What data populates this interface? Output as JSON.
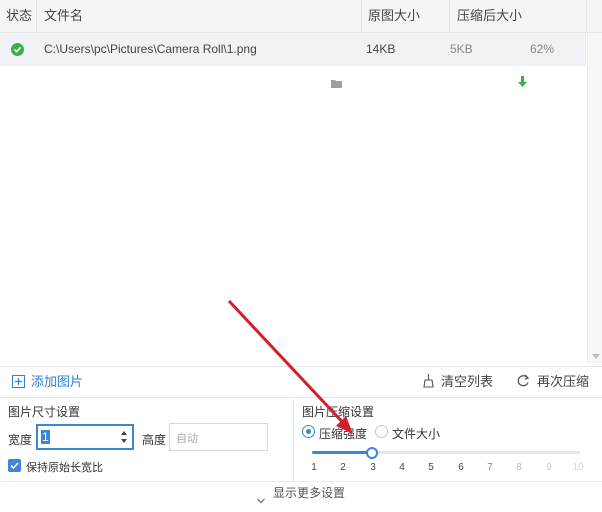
{
  "table": {
    "headers": {
      "status": "状态",
      "filename": "文件名",
      "original_size": "原图大小",
      "compressed_size": "压缩后大小"
    },
    "rows": [
      {
        "status": "success",
        "path": "C:\\Users\\pc\\Pictures\\Camera Roll\\1.png",
        "original": "14KB",
        "compressed": "5KB",
        "ratio": "62%"
      }
    ]
  },
  "toolbar": {
    "add_images": "添加图片",
    "clear_list": "清空列表",
    "recompress": "再次压缩"
  },
  "size_settings": {
    "title": "图片尺寸设置",
    "width_label": "宽度",
    "width_value": "1",
    "height_label": "高度",
    "height_placeholder": "自动",
    "keep_ratio_label": "保持原始长宽比",
    "keep_ratio_checked": true
  },
  "compress_settings": {
    "title": "图片压缩设置",
    "option_strength": "压缩强度",
    "option_filesize": "文件大小",
    "selected": "压缩强度",
    "slider_value": 3,
    "ticks": [
      "1",
      "2",
      "3",
      "4",
      "5",
      "6",
      "7",
      "8",
      "9",
      "10"
    ]
  },
  "show_more": "显示更多设置",
  "colors": {
    "accent": "#3b86d8",
    "success": "#3cae4c",
    "annotation_arrow": "#d0202a"
  }
}
